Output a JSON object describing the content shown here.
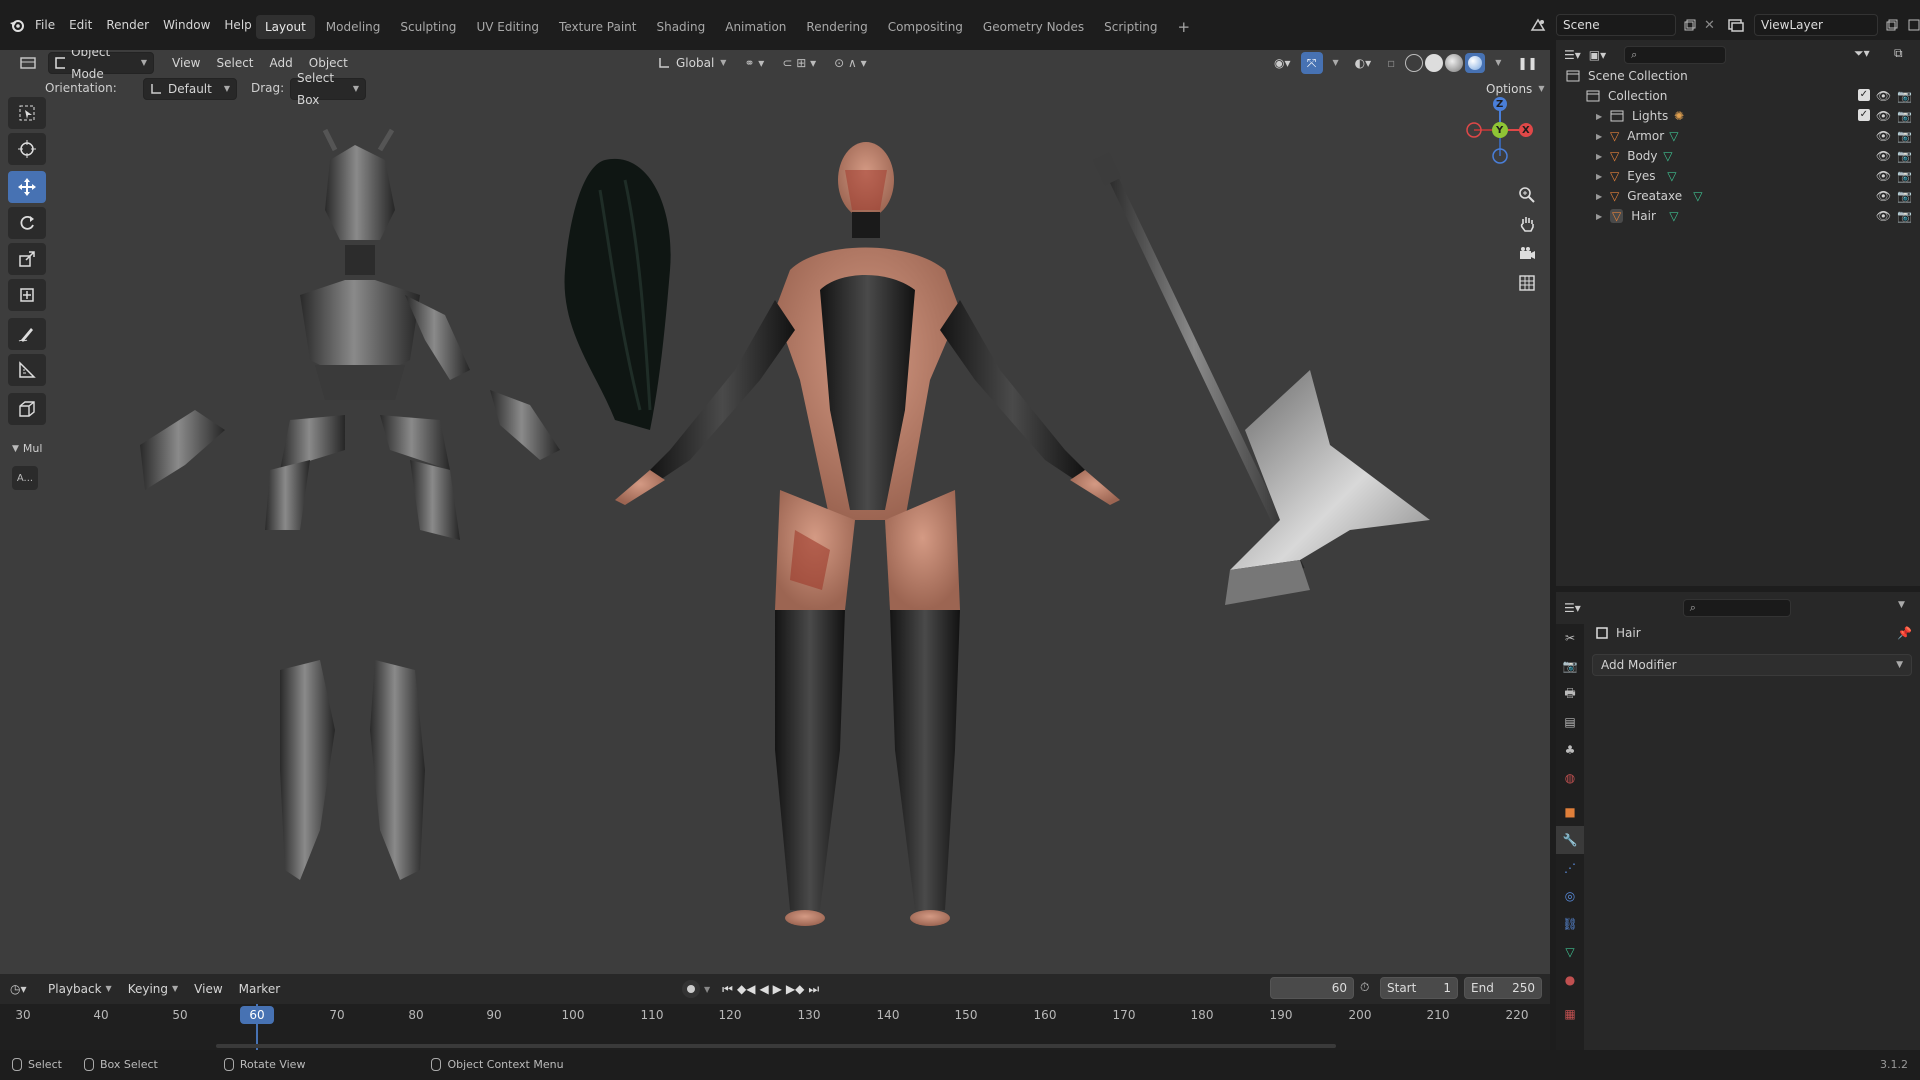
{
  "menu": {
    "items": [
      "File",
      "Edit",
      "Render",
      "Window",
      "Help"
    ]
  },
  "workspaces": {
    "tabs": [
      "Layout",
      "Modeling",
      "Sculpting",
      "UV Editing",
      "Texture Paint",
      "Shading",
      "Animation",
      "Rendering",
      "Compositing",
      "Geometry Nodes",
      "Scripting"
    ],
    "active": "Layout",
    "add_label": "+"
  },
  "scene": {
    "name": "Scene",
    "view_layer": "ViewLayer"
  },
  "viewport_header": {
    "mode": "Object Mode",
    "menus": [
      "View",
      "Select",
      "Add",
      "Object"
    ],
    "transform_orientation": "Global",
    "options_label": "Options"
  },
  "viewport_subheader": {
    "orientation_label": "Orientation:",
    "orientation_value": "Default",
    "drag_label": "Drag:",
    "drag_value": "Select Box"
  },
  "toolbar": {
    "panel_label": "Mul",
    "a_label": "A..."
  },
  "gizmo": {
    "z": "Z",
    "y": "Y",
    "x": "X"
  },
  "outliner": {
    "root": "Scene Collection",
    "collection": "Collection",
    "items": [
      "Lights",
      "Armor",
      "Body",
      "Eyes",
      "Greataxe",
      "Hair"
    ]
  },
  "properties": {
    "object_name": "Hair",
    "add_modifier": "Add Modifier"
  },
  "timeline": {
    "menus": [
      "Playback",
      "Keying",
      "View",
      "Marker"
    ],
    "current_frame": "60",
    "start_label": "Start",
    "start": "1",
    "end_label": "End",
    "end": "250",
    "ticks": [
      "30",
      "40",
      "50",
      "60",
      "70",
      "80",
      "90",
      "100",
      "110",
      "120",
      "130",
      "140",
      "150",
      "160",
      "170",
      "180",
      "190",
      "200",
      "210",
      "220"
    ]
  },
  "statusbar": {
    "select": "Select",
    "box_select": "Box Select",
    "rotate_view": "Rotate View",
    "context_menu": "Object Context Menu",
    "version": "3.1.2"
  },
  "colors": {
    "accent": "#4772b3",
    "viewport_bg": "#3d3d3d",
    "panel_bg": "#282828",
    "mesh_orange": "#e07f3a",
    "data_green": "#3fbf8f"
  }
}
